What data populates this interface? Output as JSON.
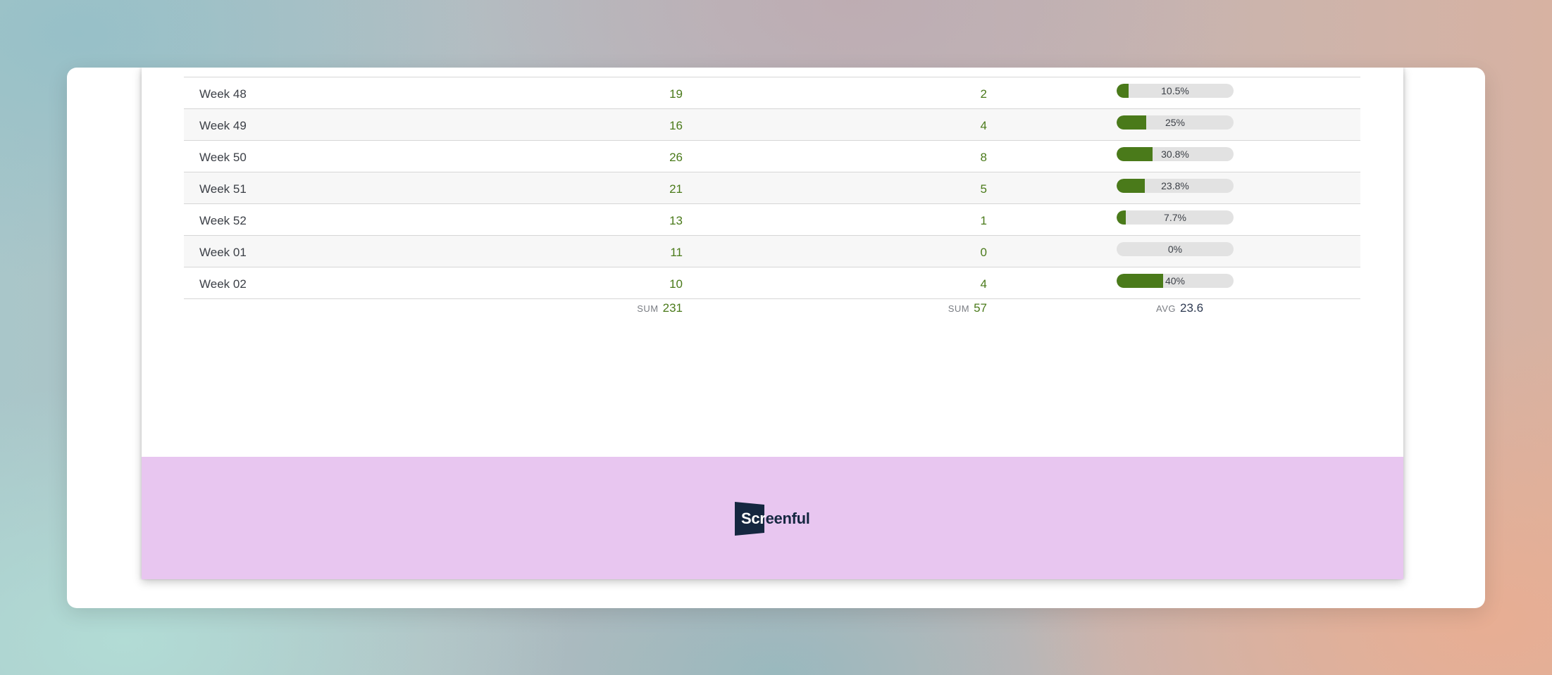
{
  "table": {
    "rows": [
      {
        "label": "Week 48",
        "col1": "19",
        "col2": "2",
        "pct_text": "10.5%",
        "pct": 10.5
      },
      {
        "label": "Week 49",
        "col1": "16",
        "col2": "4",
        "pct_text": "25%",
        "pct": 25
      },
      {
        "label": "Week 50",
        "col1": "26",
        "col2": "8",
        "pct_text": "30.8%",
        "pct": 30.8
      },
      {
        "label": "Week 51",
        "col1": "21",
        "col2": "5",
        "pct_text": "23.8%",
        "pct": 23.8
      },
      {
        "label": "Week 52",
        "col1": "13",
        "col2": "1",
        "pct_text": "7.7%",
        "pct": 7.7
      },
      {
        "label": "Week 01",
        "col1": "11",
        "col2": "0",
        "pct_text": "0%",
        "pct": 0
      },
      {
        "label": "Week 02",
        "col1": "10",
        "col2": "4",
        "pct_text": "40%",
        "pct": 40
      }
    ],
    "totals": {
      "col1_label": "SUM",
      "col1_value": "231",
      "col2_label": "SUM",
      "col2_value": "57",
      "col3_label": "AVG",
      "col3_value": "23.6"
    }
  },
  "footer": {
    "logo_text_inverse": "Scr",
    "logo_text_rest": "eenful",
    "logo_icon": "screenful-logo-mark"
  },
  "colors": {
    "accent_green": "#4a7a1a",
    "footer_bg": "#e8c6f0",
    "logo_navy": "#152740",
    "bar_track": "#e2e2e2"
  }
}
